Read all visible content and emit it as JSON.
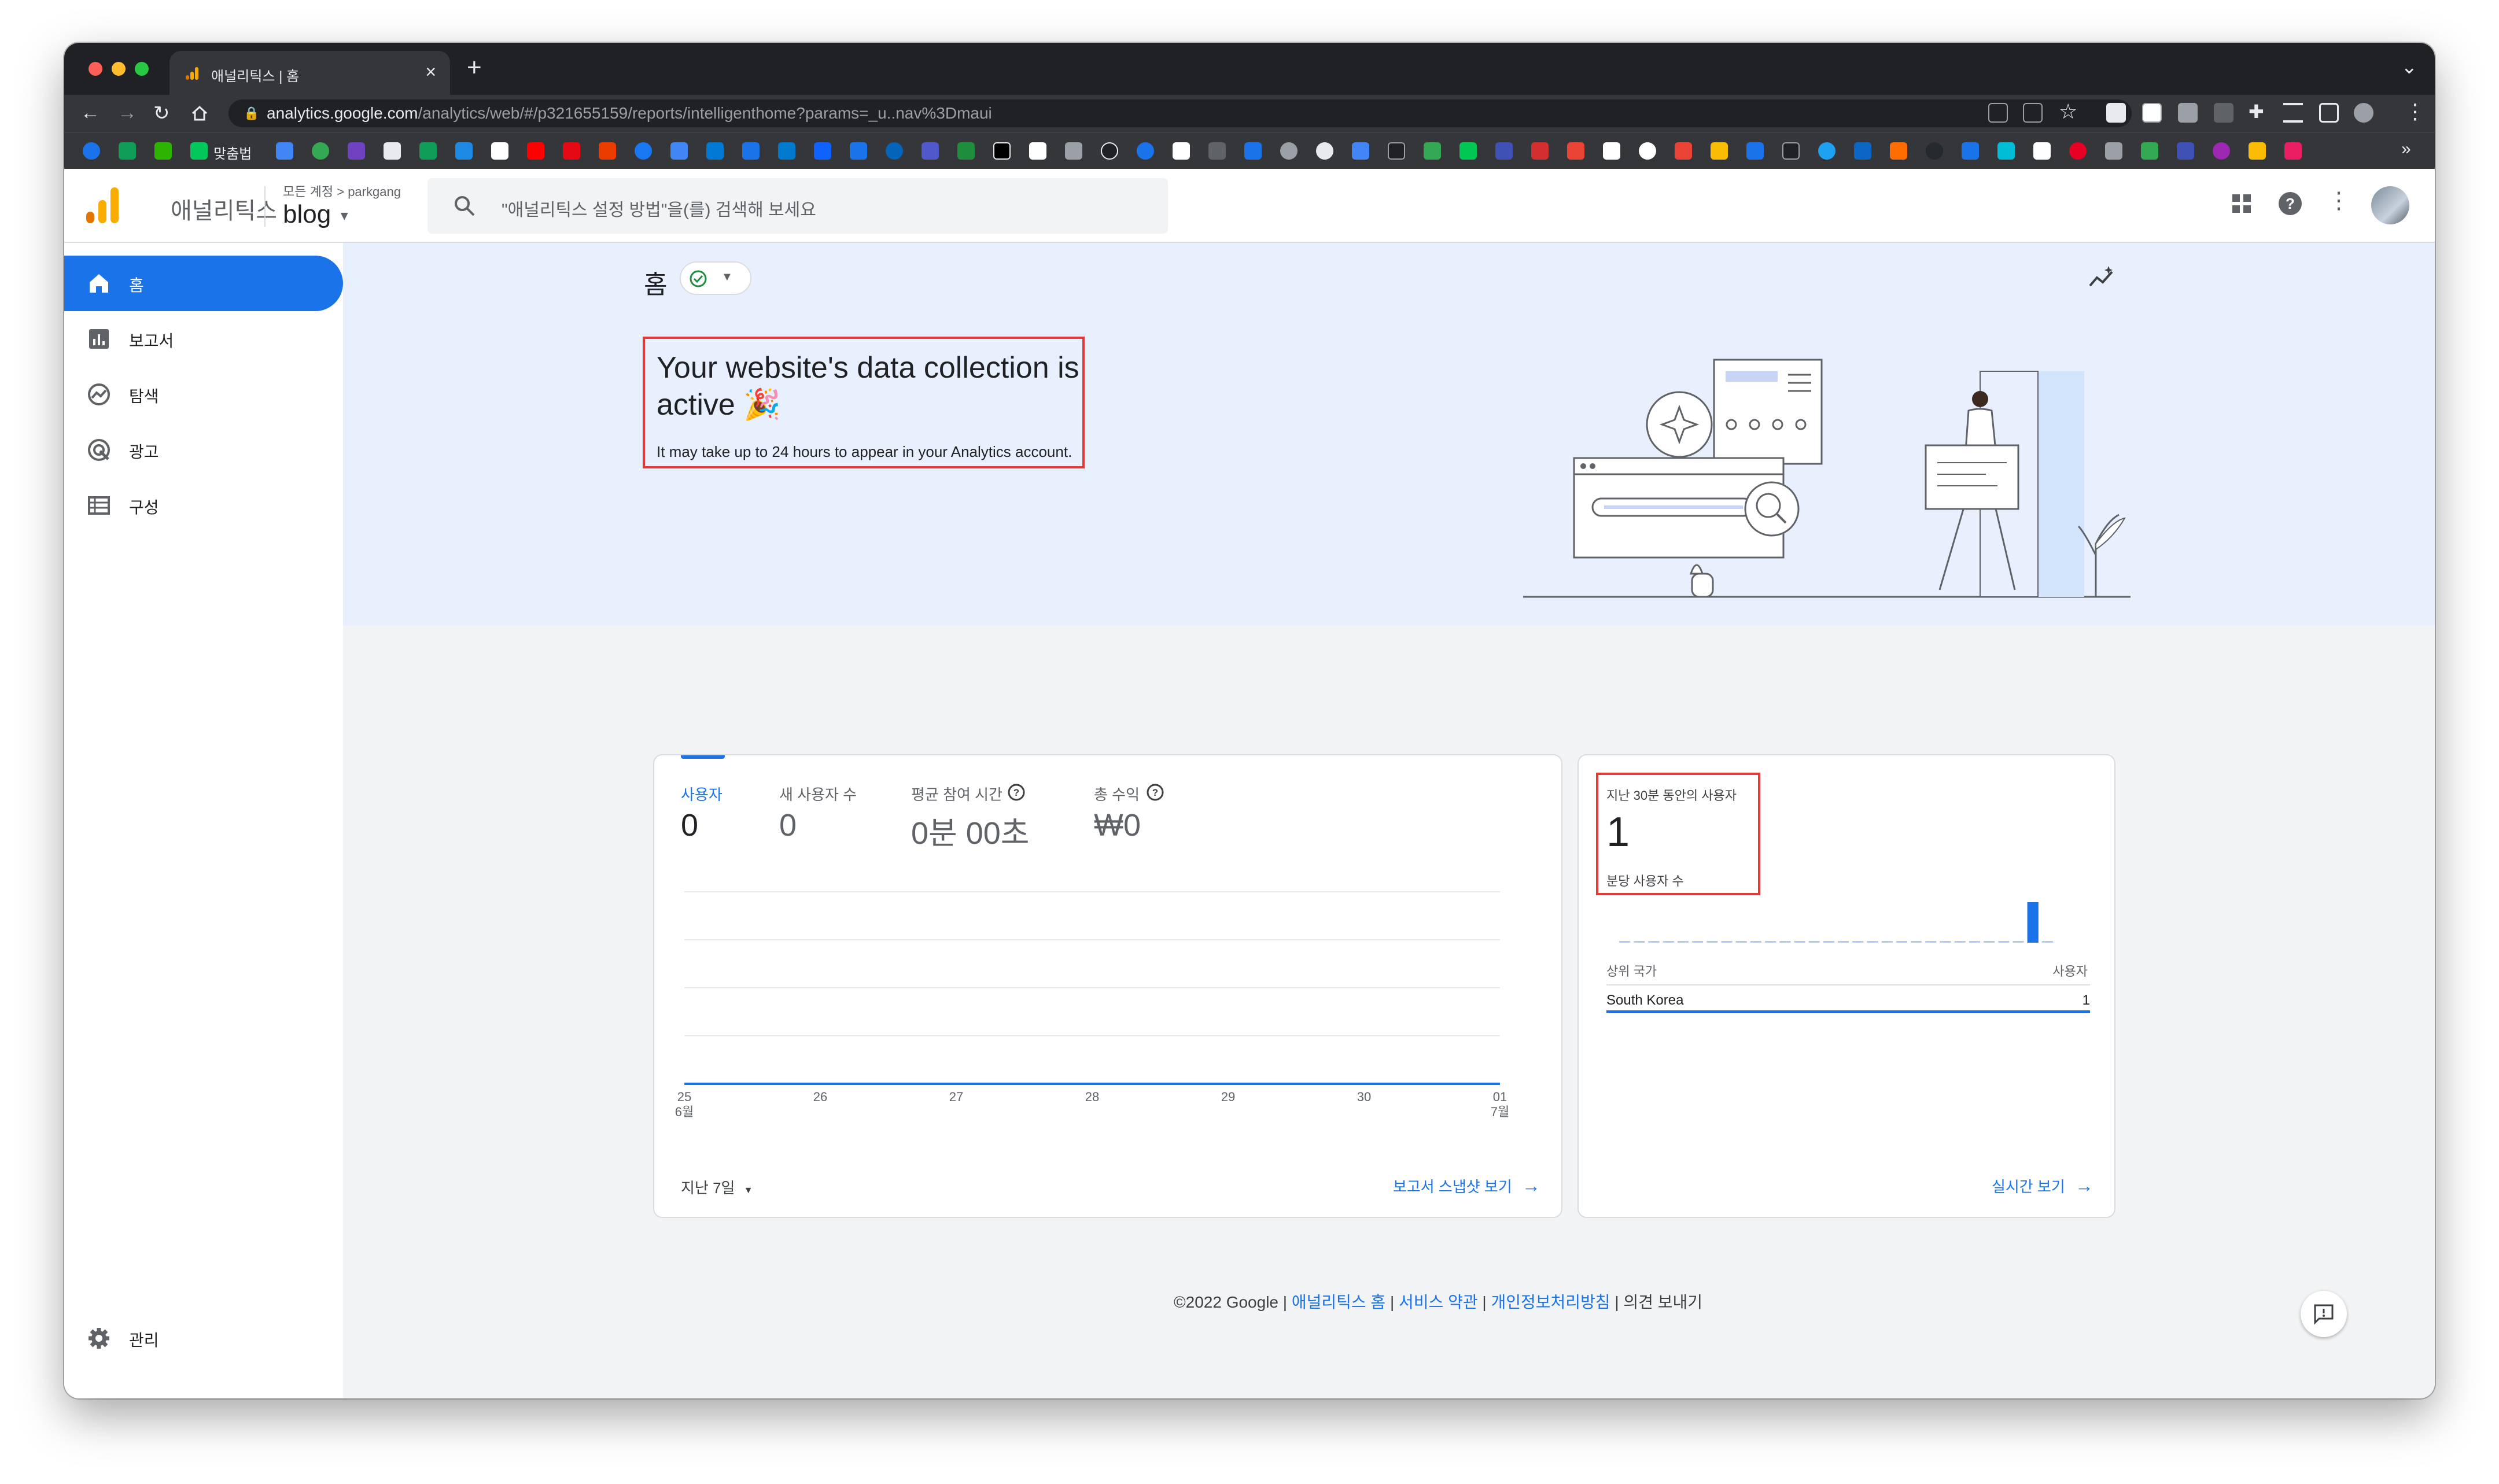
{
  "browser": {
    "tab_title": "애널리틱스 | 홈",
    "url_host": "analytics.google.com",
    "url_path": "/analytics/web/#/p321655159/reports/intelligenthome?params=_u..nav%3Dmaui",
    "bookmark_label": "맞춤법",
    "colors": {
      "close": "#ff5f57",
      "minimize": "#febc2e",
      "zoom": "#28c840"
    }
  },
  "header": {
    "brand": "애널리틱스",
    "crumb_all": "모든 계정",
    "crumb_sep": ">",
    "crumb_account": "parkgang",
    "property": "blog",
    "search_placeholder": "\"애널리틱스 설정 방법\"을(를) 검색해 보세요"
  },
  "sidebar": {
    "items": [
      {
        "label": "홈",
        "icon": "home-icon",
        "active": true
      },
      {
        "label": "보고서",
        "icon": "bar-chart-icon",
        "active": false
      },
      {
        "label": "탐색",
        "icon": "explore-icon",
        "active": false
      },
      {
        "label": "광고",
        "icon": "advertising-icon",
        "active": false
      },
      {
        "label": "구성",
        "icon": "configure-icon",
        "active": false
      }
    ],
    "admin_label": "관리"
  },
  "home": {
    "title": "홈",
    "banner_title": "Your website's data collection is active 🎉",
    "banner_subtitle": "It may take up to 24 hours to appear in your Analytics account."
  },
  "overview_card": {
    "metrics": [
      {
        "label": "사용자",
        "value": "0",
        "active": true
      },
      {
        "label": "새 사용자 수",
        "value": "0",
        "active": false
      },
      {
        "label": "평균 참여 시간",
        "value": "0분 00초",
        "active": false
      },
      {
        "label": "총 수익",
        "value": "₩0",
        "active": false
      }
    ],
    "date_range": "지난 7일",
    "snapshot_link": "보고서 스냅샷 보기"
  },
  "realtime_card": {
    "title": "지난 30분 동안의 사용자",
    "value": "1",
    "sublabel": "분당 사용자 수",
    "col_country": "상위 국가",
    "col_users": "사용자",
    "rows": [
      {
        "country": "South Korea",
        "users": "1"
      }
    ],
    "realtime_link": "실시간 보기"
  },
  "chart_data": {
    "type": "line",
    "categories": [
      "25\n6월",
      "26",
      "27",
      "28",
      "29",
      "30",
      "01\n7월"
    ],
    "tick_top": [
      "25",
      "26",
      "27",
      "28",
      "29",
      "30",
      "01"
    ],
    "tick_bottom": [
      "6월",
      "",
      "",
      "",
      "",
      "",
      "7월"
    ],
    "series": [
      {
        "name": "사용자",
        "values": [
          0,
          0,
          0,
          0,
          0,
          0,
          0
        ]
      }
    ],
    "ylim": [
      0,
      4
    ],
    "grid": true
  },
  "realtime_chart": {
    "type": "bar",
    "minutes": 30,
    "values": [
      0,
      0,
      0,
      0,
      0,
      0,
      0,
      0,
      0,
      0,
      0,
      0,
      0,
      0,
      0,
      0,
      0,
      0,
      0,
      0,
      0,
      0,
      0,
      0,
      0,
      0,
      0,
      0,
      1,
      0
    ]
  },
  "footer": {
    "copyright": "©2022 Google",
    "sep": "|",
    "links": [
      "애널리틱스 홈",
      "서비스 약관",
      "개인정보처리방침"
    ],
    "feedback": "의견 보내기"
  }
}
